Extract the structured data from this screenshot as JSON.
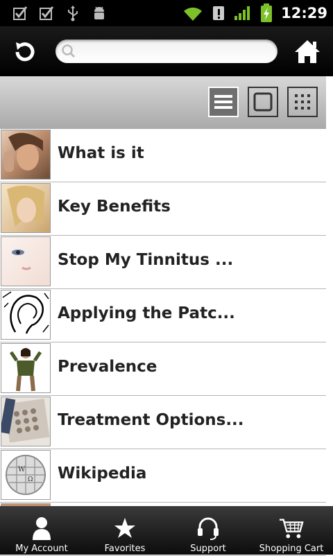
{
  "status_bar": {
    "time": "12:29"
  },
  "search": {
    "placeholder": "",
    "value": ""
  },
  "view_modes": [
    {
      "name": "list",
      "active": true
    },
    {
      "name": "single",
      "active": false
    },
    {
      "name": "grid",
      "active": false
    }
  ],
  "list": {
    "items": [
      {
        "label": "What is it"
      },
      {
        "label": "Key Benefits"
      },
      {
        "label": "Stop My Tinnitus ..."
      },
      {
        "label": "Applying the Patc..."
      },
      {
        "label": "Prevalence"
      },
      {
        "label": "Treatment Options..."
      },
      {
        "label": "Wikipedia"
      }
    ]
  },
  "tabs": [
    {
      "label": "My Account",
      "icon": "person-icon"
    },
    {
      "label": "Favorites",
      "icon": "star-icon"
    },
    {
      "label": "Support",
      "icon": "headset-icon"
    },
    {
      "label": "Shopping Cart",
      "icon": "cart-icon"
    }
  ],
  "colors": {
    "accent_battery": "#7cc12a",
    "signal": "#7cc12a",
    "status_bg": "#000000"
  }
}
